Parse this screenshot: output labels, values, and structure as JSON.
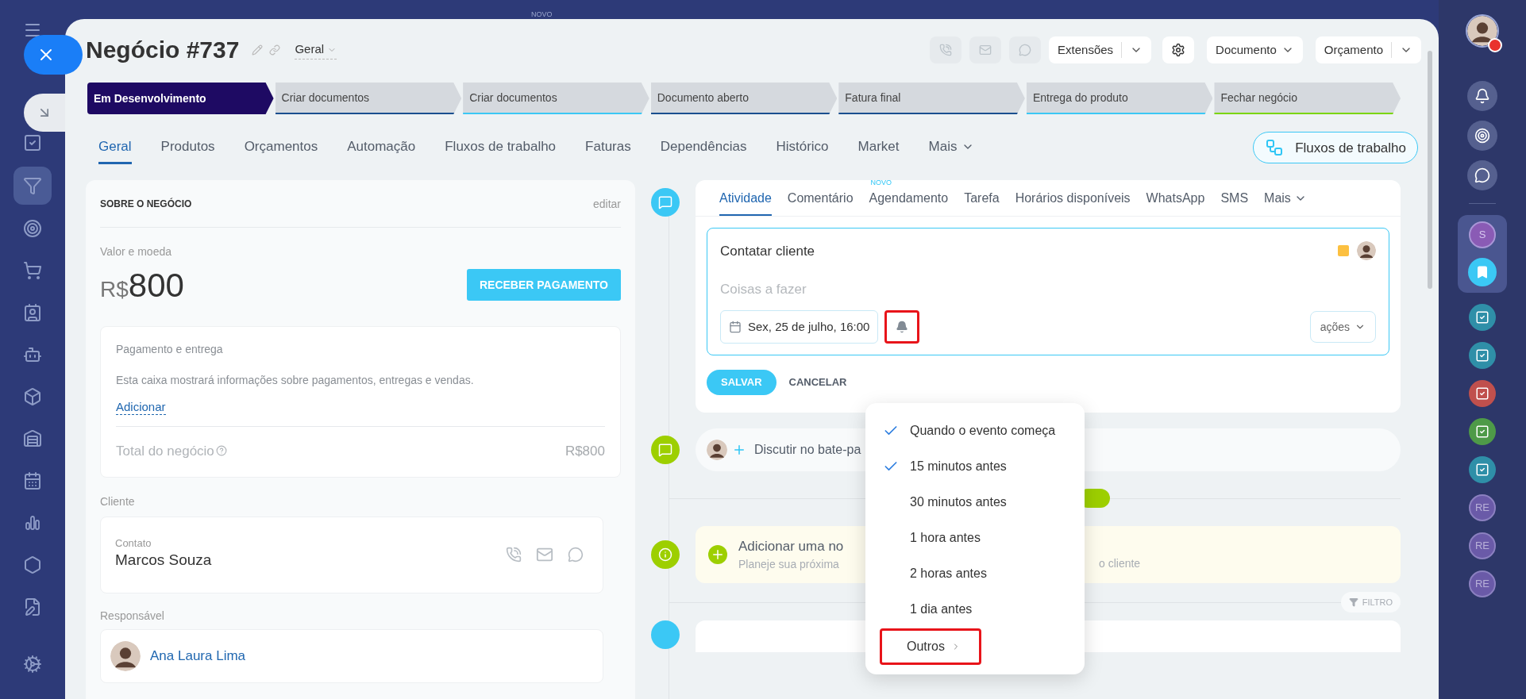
{
  "background_badge": "NOVO",
  "header": {
    "title": "Negócio #737",
    "view": "Geral",
    "extensions": "Extensões",
    "document": "Documento",
    "estimate": "Orçamento"
  },
  "pipeline": [
    {
      "label": "Em Desenvolvimento",
      "selected": true,
      "color": "#1e0a63"
    },
    {
      "label": "Criar documentos",
      "selected": false,
      "color": "#1a4f8f"
    },
    {
      "label": "Criar documentos",
      "selected": false,
      "color": "#3bc8f5"
    },
    {
      "label": "Documento aberto",
      "selected": false,
      "color": "#1a4f8f"
    },
    {
      "label": "Fatura final",
      "selected": false,
      "color": "#1a4f8f"
    },
    {
      "label": "Entrega do produto",
      "selected": false,
      "color": "#3bc8f5"
    },
    {
      "label": "Fechar negócio",
      "selected": false,
      "color": "#7bd500"
    }
  ],
  "tabs": [
    {
      "label": "Geral",
      "selected": true
    },
    {
      "label": "Produtos",
      "selected": false
    },
    {
      "label": "Orçamentos",
      "selected": false
    },
    {
      "label": "Automação",
      "selected": false
    },
    {
      "label": "Fluxos de trabalho",
      "selected": false
    },
    {
      "label": "Faturas",
      "selected": false
    },
    {
      "label": "Dependências",
      "selected": false
    },
    {
      "label": "Histórico",
      "selected": false
    },
    {
      "label": "Market",
      "selected": false
    },
    {
      "label": "Mais",
      "selected": false
    }
  ],
  "workflow_button": "Fluxos de trabalho",
  "about": {
    "heading": "SOBRE O NEGÓCIO",
    "edit": "editar",
    "value_label": "Valor e moeda",
    "currency": "R$",
    "amount": "800",
    "pay_button": "RECEBER PAGAMENTO",
    "payment": {
      "title": "Pagamento e entrega",
      "description": "Esta caixa mostrará informações sobre pagamentos, entregas e vendas.",
      "link": "Adicionar",
      "total_label": "Total do negócio",
      "total_value": "R$800"
    },
    "client_label": "Cliente",
    "contact_label": "Contato",
    "contact_name": "Marcos Souza",
    "responsible_label": "Responsável",
    "responsible_name": "Ana Laura Lima"
  },
  "activity": {
    "tabs": [
      {
        "label": "Atividade",
        "selected": true
      },
      {
        "label": "Comentário",
        "selected": false
      },
      {
        "label": "Agendamento",
        "selected": false,
        "badge": "NOVO"
      },
      {
        "label": "Tarefa",
        "selected": false
      },
      {
        "label": "Horários disponíveis",
        "selected": false
      },
      {
        "label": "WhatsApp",
        "selected": false
      },
      {
        "label": "SMS",
        "selected": false
      },
      {
        "label": "Mais",
        "selected": false
      }
    ],
    "title": "Contatar cliente",
    "placeholder": "Coisas a fazer",
    "date": "Sex, 25 de julho, 16:00",
    "actions": "ações",
    "save": "SALVAR",
    "cancel": "CANCELAR"
  },
  "timeline": {
    "discuss": "Discutir no bate-pa",
    "add_title": "Adicionar uma no",
    "add_subtitle": "Planeje sua próxima",
    "add_subtitle_end": "o cliente",
    "filter": "FILTRO"
  },
  "reminder_menu": [
    {
      "label": "Quando o evento começa",
      "checked": true,
      "kind": "option"
    },
    {
      "label": "15 minutos antes",
      "checked": true,
      "kind": "option"
    },
    {
      "label": "30 minutos antes",
      "checked": false,
      "kind": "option"
    },
    {
      "label": "1 hora antes",
      "checked": false,
      "kind": "option"
    },
    {
      "label": "2 horas antes",
      "checked": false,
      "kind": "option"
    },
    {
      "label": "1 dia antes",
      "checked": false,
      "kind": "option"
    },
    {
      "label": "Outros",
      "kind": "submenu"
    }
  ],
  "right_bar": {
    "avatars": [
      {
        "letters": "S",
        "color": "#8a5bb5"
      },
      {
        "letters": "RE",
        "color": "#6a5aa8"
      },
      {
        "letters": "RE",
        "color": "#6a5aa8"
      },
      {
        "letters": "RE",
        "color": "#6a5aa8"
      }
    ],
    "tasks": [
      {
        "color": "#2f8fa8"
      },
      {
        "color": "#2f8fa8"
      },
      {
        "color": "#c0504d"
      },
      {
        "color": "#4e9a48"
      },
      {
        "color": "#2f8fa8"
      }
    ]
  }
}
